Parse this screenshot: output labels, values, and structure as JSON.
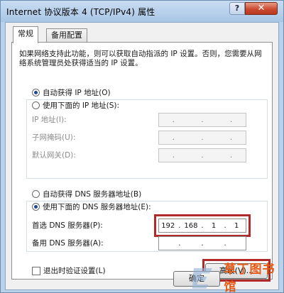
{
  "window": {
    "title": "Internet 协议版本 4 (TCP/IPv4) 属性",
    "help_label": "?",
    "close_label": "✕"
  },
  "tabs": [
    {
      "label": "常规"
    },
    {
      "label": "备用配置"
    }
  ],
  "intro_text": "如果网络支持此功能，则可以获取自动指派的 IP 设置。否则，您需要从网络系统管理员处获得适当的 IP 设置。",
  "ip_section": {
    "auto_radio": "自动获得 IP 地址(O)",
    "manual_radio": "使用下面的 IP 地址(S):",
    "auto_selected": true,
    "fields": [
      {
        "label": "IP 地址(I):",
        "value": [
          ".",
          ".",
          "."
        ]
      },
      {
        "label": "子网掩码(U):",
        "value": [
          ".",
          ".",
          "."
        ]
      },
      {
        "label": "默认网关(D):",
        "value": [
          ".",
          ".",
          "."
        ]
      }
    ]
  },
  "dns_section": {
    "auto_radio": "自动获得 DNS 服务器地址(B)",
    "manual_radio": "使用下面的 DNS 服务器地址(E):",
    "manual_selected": true,
    "preferred": {
      "label": "首选 DNS 服务器(P):",
      "octets": [
        "192",
        "168",
        "1",
        "1"
      ]
    },
    "alternate": {
      "label": "备用 DNS 服务器(A):",
      "octets": [
        "",
        "",
        "",
        ""
      ]
    }
  },
  "validate_checkbox": "退出时验证设置(L)",
  "advanced_button": "高级(V)...",
  "ok_button": "确定",
  "watermark": {
    "text": "草丁图书馆"
  },
  "colors": {
    "highlight": "#b02a2a",
    "watermark": "#e65b15"
  }
}
